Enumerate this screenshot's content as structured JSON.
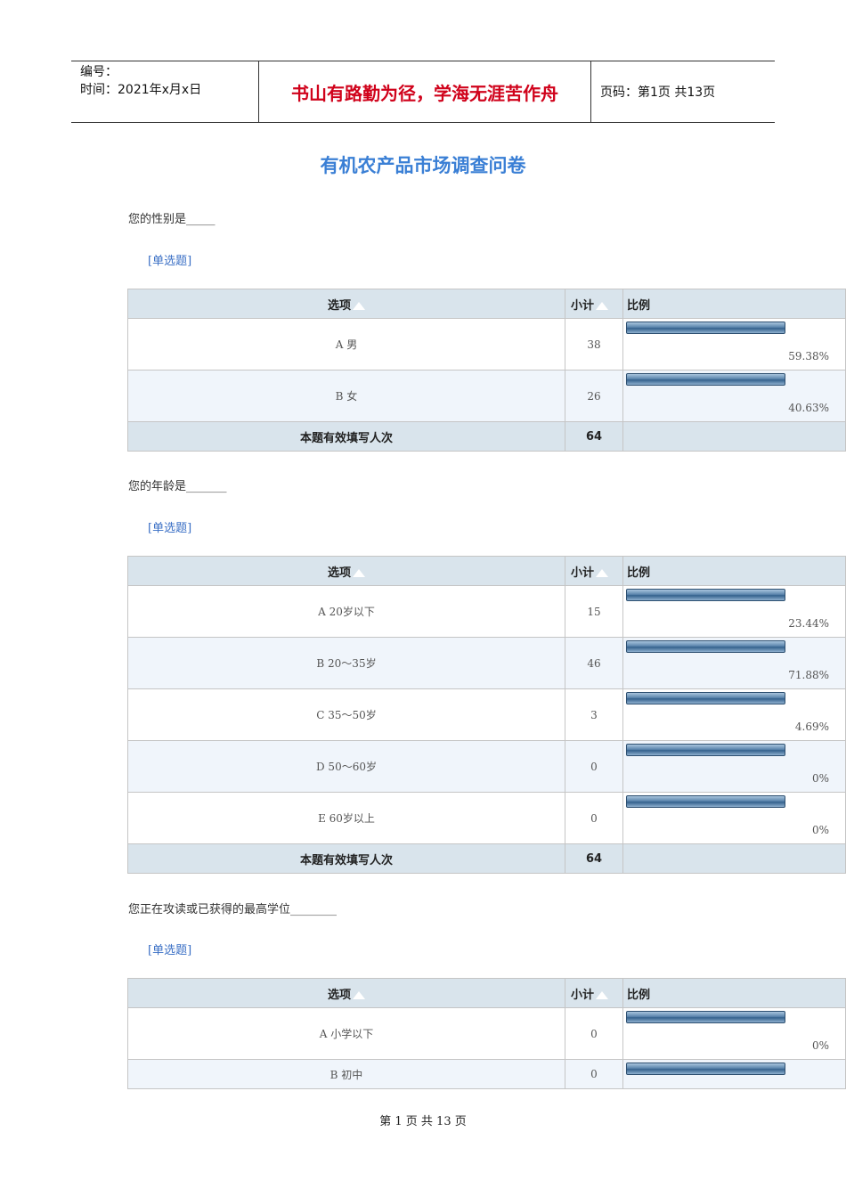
{
  "header": {
    "number_label": "编号：",
    "time_label": "时间：2021年x月x日",
    "motto": "书山有路勤为径，学海无涯苦作舟",
    "page_label": "页码：第1页  共13页"
  },
  "title": "有机农产品市场调查问卷",
  "table_headers": {
    "option": "选项",
    "count": "小计",
    "percent": "比例"
  },
  "questions": [
    {
      "text": "您的性别是_____",
      "type": "[单选题]",
      "rows": [
        {
          "option": "A  男",
          "count": "38",
          "percent": "59.38%",
          "fraction": 0.5938
        },
        {
          "option": "B  女",
          "count": "26",
          "percent": "40.63%",
          "fraction": 0.4063
        }
      ],
      "total_label": "本题有效填写人次",
      "total": "64"
    },
    {
      "text": "您的年龄是_______",
      "type": "[单选题]",
      "rows": [
        {
          "option": "A  20岁以下",
          "count": "15",
          "percent": "23.44%",
          "fraction": 0.2344
        },
        {
          "option": "B  20～35岁",
          "count": "46",
          "percent": "71.88%",
          "fraction": 0.7188
        },
        {
          "option": "C  35～50岁",
          "count": "3",
          "percent": "4.69%",
          "fraction": 0.0469
        },
        {
          "option": "D  50～60岁",
          "count": "0",
          "percent": "0%",
          "fraction": 0
        },
        {
          "option": "E  60岁以上",
          "count": "0",
          "percent": "0%",
          "fraction": 0
        }
      ],
      "total_label": "本题有效填写人次",
      "total": "64"
    },
    {
      "text": "您正在攻读或已获得的最高学位________",
      "type": "[单选题]",
      "rows": [
        {
          "option": "A  小学以下",
          "count": "0",
          "percent": "0%",
          "fraction": 0
        },
        {
          "option": "B  初中",
          "count": "0",
          "percent": "",
          "fraction": 0
        }
      ]
    }
  ],
  "footer": "第 1 页 共 13 页"
}
